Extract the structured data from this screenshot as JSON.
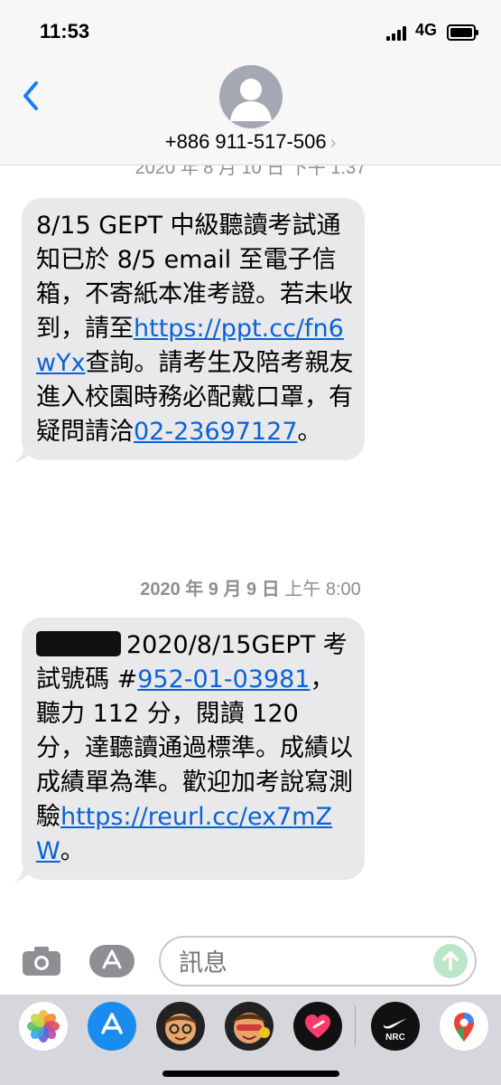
{
  "status_bar": {
    "time": "11:53",
    "network": "4G"
  },
  "header": {
    "contact": "+886 911-517-506",
    "chevron": "›"
  },
  "messages": [
    {
      "timestamp_top_partial": "2020 年 8 月 10 日 下午 1:37",
      "parts": {
        "t1": "8/15 GEPT 中級聽讀考試通知已於 8/5 email 至電子信箱，不寄紙本准考證。若未收到，請至",
        "link1": "https://ppt.cc/fn6wYx",
        "t2": "查詢。請考生及陪考親友進入校園時務必配戴口罩，有疑問請洽",
        "link2": "02-23697127",
        "t3": "。"
      }
    },
    {
      "timestamp": {
        "date": "2020 年 9 月 9 日",
        "time": "上午 8:00"
      },
      "parts": {
        "t1": "2020/8/15GEPT 考試號碼 #",
        "link1": "952-01-03981",
        "t2": "，聽力 112 分，閱讀 120 分，達聽讀通過標準。成績以成績單為準。歡迎加考說寫測驗",
        "link2": "https://reurl.cc/ex7mZW",
        "t3": "。"
      }
    }
  ],
  "input": {
    "placeholder": "訊息"
  },
  "drawer_apps": [
    {
      "name": "photos"
    },
    {
      "name": "app-store"
    },
    {
      "name": "memoji"
    },
    {
      "name": "memoji-stickers"
    },
    {
      "name": "digital-touch"
    },
    {
      "name": "nrc",
      "label": "NRC"
    },
    {
      "name": "google-maps"
    }
  ],
  "colors": {
    "link": "#0a62d6",
    "bubble": "#e9e9eb",
    "accent": "#1a7cf5",
    "send": "#bfe5c8"
  }
}
